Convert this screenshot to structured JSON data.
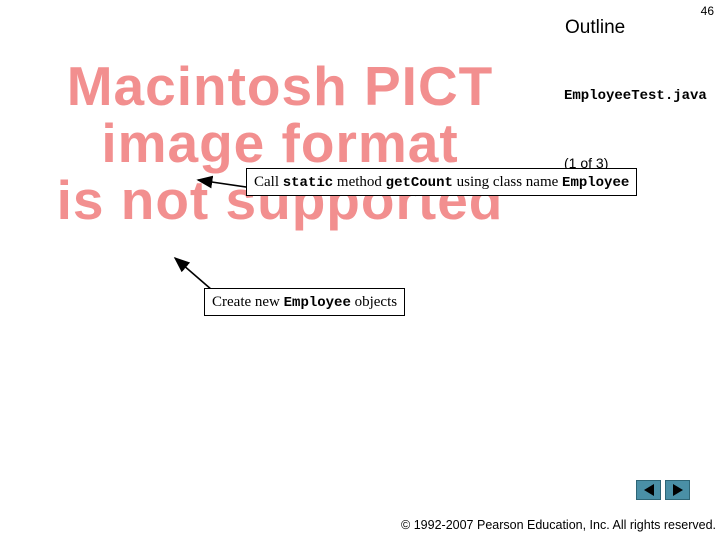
{
  "slide": {
    "page_number": "46",
    "outline_title": "Outline",
    "file_name": "EmployeeTest.java",
    "page_indicator": "(1 of 3)"
  },
  "image_placeholder": {
    "lines": [
      "Macintosh PICT",
      "image format",
      "is not supported"
    ]
  },
  "callouts": {
    "static_method": {
      "text1": "Call ",
      "code1": "static",
      "text2": " method ",
      "code2": "getCount",
      "text3": " using class name ",
      "code3": "Employee"
    },
    "create_objects": {
      "text1": "Create new ",
      "code1": "Employee",
      "text2": " objects"
    }
  },
  "navigation": {
    "prev_icon": "triangle-left-icon",
    "next_icon": "triangle-right-icon",
    "button_color": "#4a8fa6"
  },
  "footer": {
    "copyright": "© 1992-2007 Pearson Education, Inc.  All rights reserved."
  }
}
